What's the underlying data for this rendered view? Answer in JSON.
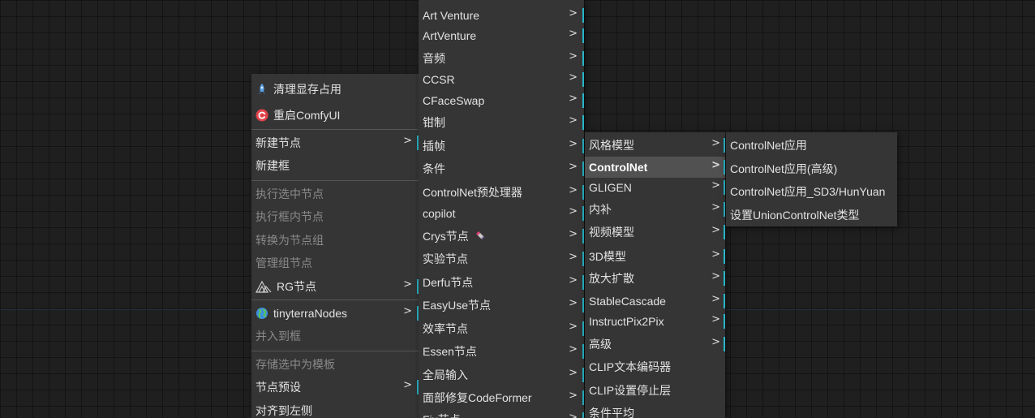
{
  "canvas_menu": {
    "items": [
      {
        "label": "清理显存占用",
        "icon": "rocket-icon"
      },
      {
        "label": "重启ComfyUI",
        "icon": "restart-icon"
      },
      {
        "label": "新建节点",
        "submenu": true
      },
      {
        "label": "新建框"
      },
      {
        "label": "执行选中节点",
        "disabled": true
      },
      {
        "label": "执行框内节点",
        "disabled": true
      },
      {
        "label": "转换为节点组",
        "disabled": true
      },
      {
        "label": "管理组节点",
        "disabled": true
      },
      {
        "label": "RG节点",
        "icon": "rg-logo-icon",
        "submenu": true
      },
      {
        "label": "tinyterraNodes",
        "icon": "globe-icon",
        "submenu": true
      },
      {
        "label": "并入到框",
        "disabled": true
      },
      {
        "label": "存储选中为模板",
        "disabled": true
      },
      {
        "label": "节点预设",
        "submenu": true
      },
      {
        "label": "对齐到左侧"
      }
    ]
  },
  "categories_menu": {
    "items": [
      {
        "label": "Art Venture"
      },
      {
        "label": "ArtVenture"
      },
      {
        "label": "音频"
      },
      {
        "label": "CCSR"
      },
      {
        "label": "CFaceSwap"
      },
      {
        "label": "钳制"
      },
      {
        "label": "插帧"
      },
      {
        "label": "条件"
      },
      {
        "label": "ControlNet预处理器"
      },
      {
        "label": "copilot"
      },
      {
        "label": "Crys节点",
        "trailing_icon": "lipstick-icon"
      },
      {
        "label": "实验节点"
      },
      {
        "label": "Derfu节点"
      },
      {
        "label": "EasyUse节点"
      },
      {
        "label": "效率节点"
      },
      {
        "label": "Essen节点"
      },
      {
        "label": "全局输入"
      },
      {
        "label": "面部修复CodeFormer"
      },
      {
        "label": "Fix节点"
      }
    ]
  },
  "conditioning_menu": {
    "items": [
      {
        "label": "风格模型",
        "submenu": true
      },
      {
        "label": "ControlNet",
        "submenu": true,
        "highlighted": true
      },
      {
        "label": "GLIGEN",
        "submenu": true
      },
      {
        "label": "内补",
        "submenu": true
      },
      {
        "label": "视频模型",
        "submenu": true
      },
      {
        "label": "3D模型",
        "submenu": true
      },
      {
        "label": "放大扩散",
        "submenu": true
      },
      {
        "label": "StableCascade",
        "submenu": true
      },
      {
        "label": "InstructPix2Pix",
        "submenu": true
      },
      {
        "label": "高级",
        "submenu": true
      },
      {
        "label": "CLIP文本编码器"
      },
      {
        "label": "CLIP设置停止层"
      },
      {
        "label": "条件平均"
      }
    ]
  },
  "controlnet_menu": {
    "items": [
      {
        "label": "ControlNet应用"
      },
      {
        "label": "ControlNet应用(高级)"
      },
      {
        "label": "ControlNet应用_SD3/HunYuan"
      },
      {
        "label": "设置UnionControlNet类型"
      }
    ]
  },
  "arrow_glyph": ">",
  "colors": {
    "accent": "#28b4c8",
    "menu_bg": "#353535",
    "highlight_bg": "#515151"
  }
}
